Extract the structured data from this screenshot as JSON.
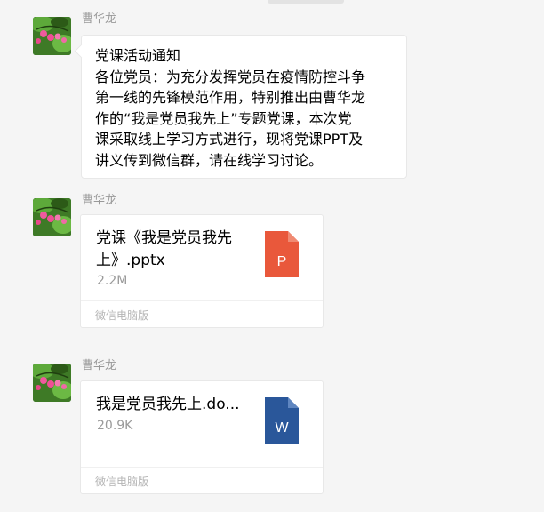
{
  "messages": [
    {
      "sender": "曹华龙",
      "type": "text",
      "text": "党课活动通知\n各位党员：为充分发挥党员在疫情防控斗争\n第一线的先锋模范作用，特别推出由曹华龙\n作的“我是党员我先上”专题党课，本次党\n课采取线上学习方式进行，现将党课PPT及\n讲义传到微信群，请在线学习讨论。"
    },
    {
      "sender": "曹华龙",
      "type": "file",
      "file_name": "党课《我是党员我先上》.pptx",
      "file_size": "2.2M",
      "icon_letter": "P",
      "icon_color": "#e9583b",
      "icon": "pptx-file-icon",
      "source": "微信电脑版"
    },
    {
      "sender": "曹华龙",
      "type": "file",
      "file_name": "我是党员我先上.do...",
      "file_size": "20.9K",
      "icon_letter": "W",
      "icon_color": "#2a579a",
      "icon": "docx-file-icon",
      "source": "微信电脑版"
    }
  ]
}
